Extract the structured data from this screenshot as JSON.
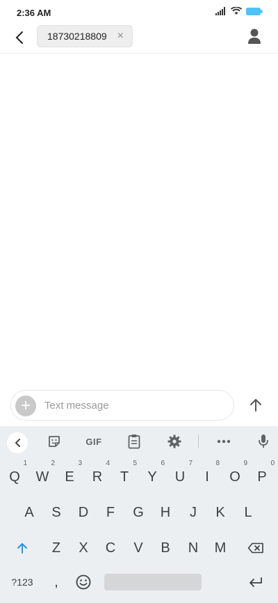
{
  "status_bar": {
    "time": "2:36 AM"
  },
  "header": {
    "recipient": "18730218809",
    "remove_symbol": "×"
  },
  "compose": {
    "placeholder": "Text message",
    "attach_symbol": "+"
  },
  "keyboard": {
    "toolbar": {
      "gif_label": "GIF"
    },
    "row1": [
      {
        "label": "Q",
        "hint": "1"
      },
      {
        "label": "W",
        "hint": "2"
      },
      {
        "label": "E",
        "hint": "3"
      },
      {
        "label": "R",
        "hint": "4"
      },
      {
        "label": "T",
        "hint": "5"
      },
      {
        "label": "Y",
        "hint": "6"
      },
      {
        "label": "U",
        "hint": "7"
      },
      {
        "label": "I",
        "hint": "8"
      },
      {
        "label": "O",
        "hint": "9"
      },
      {
        "label": "P",
        "hint": "0"
      }
    ],
    "row2": [
      "A",
      "S",
      "D",
      "F",
      "G",
      "H",
      "J",
      "K",
      "L"
    ],
    "row3": [
      "Z",
      "X",
      "C",
      "V",
      "B",
      "N",
      "M"
    ],
    "symbols_label": "?123",
    "comma_label": ","
  },
  "colors": {
    "accent": "#2196f3",
    "battery": "#4fc3f7",
    "keyboard_bg": "#eceff1"
  }
}
